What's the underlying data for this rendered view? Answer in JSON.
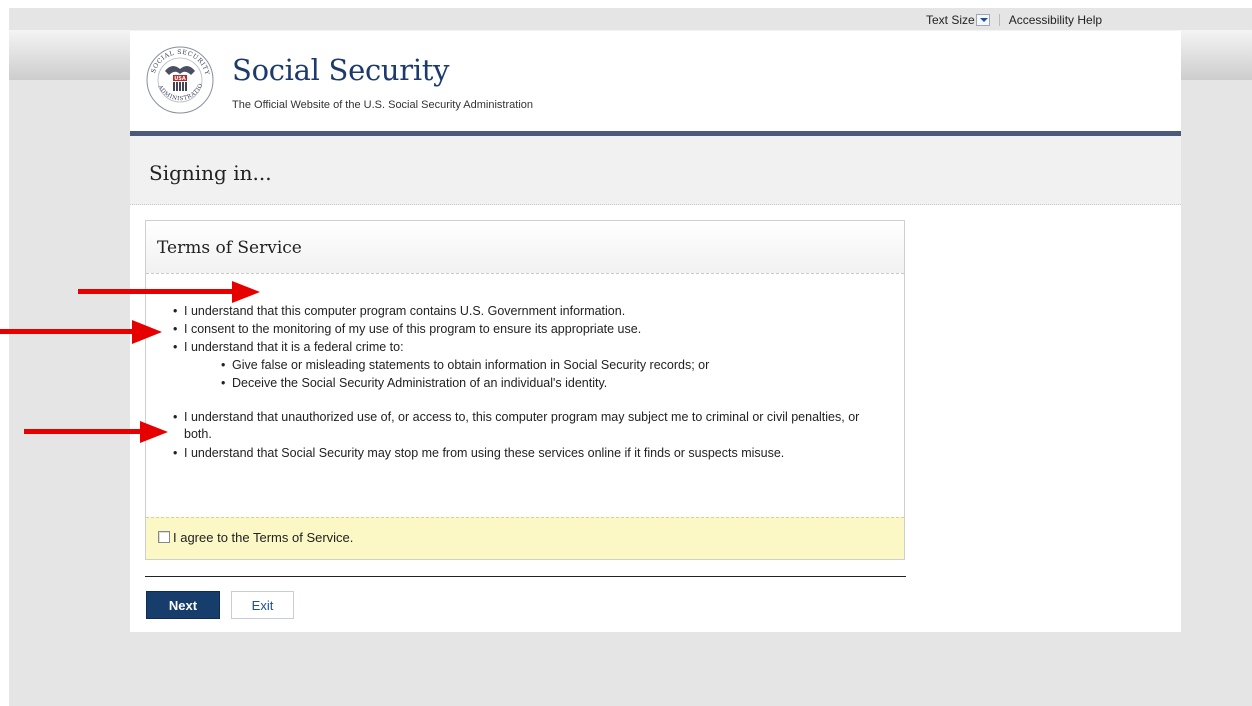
{
  "utility_bar": {
    "text_size_label": "Text Size",
    "accessibility_help_label": "Accessibility Help"
  },
  "header": {
    "site_title": "Social Security",
    "site_subtitle": "The Official Website of the U.S. Social Security Administration",
    "logo_icon": "ssa-seal-icon",
    "logo_text": "SOCIAL SECURITY ADMINISTRATION USA"
  },
  "page": {
    "title": "Signing in..."
  },
  "terms": {
    "title": "Terms of Service",
    "items": [
      "I understand that this computer program contains U.S. Government information.",
      "I consent to the monitoring of my use of this program to ensure its appropriate use.",
      "I understand that it is a federal crime to:",
      "I understand that unauthorized use of, or access to, this computer program may subject me to criminal or civil penalties, or both.",
      "I understand that Social Security may stop me from using these services online if it finds or suspects misuse."
    ],
    "sub_items": [
      "Give false or misleading statements to obtain information in Social Security records; or",
      "Deceive the Social Security Administration of an individual's identity."
    ],
    "agree_label": "I agree to the Terms of Service.",
    "agree_checked": false
  },
  "actions": {
    "next_label": "Next",
    "exit_label": "Exit"
  },
  "colors": {
    "brand_navy": "#1d3a6d",
    "rule_blue": "#4b5a7b",
    "agree_yellow": "#fbf8c6",
    "annotation_red": "#e60000"
  },
  "annotations": {
    "arrow_icon": "red-arrow-icon",
    "count": 3
  }
}
